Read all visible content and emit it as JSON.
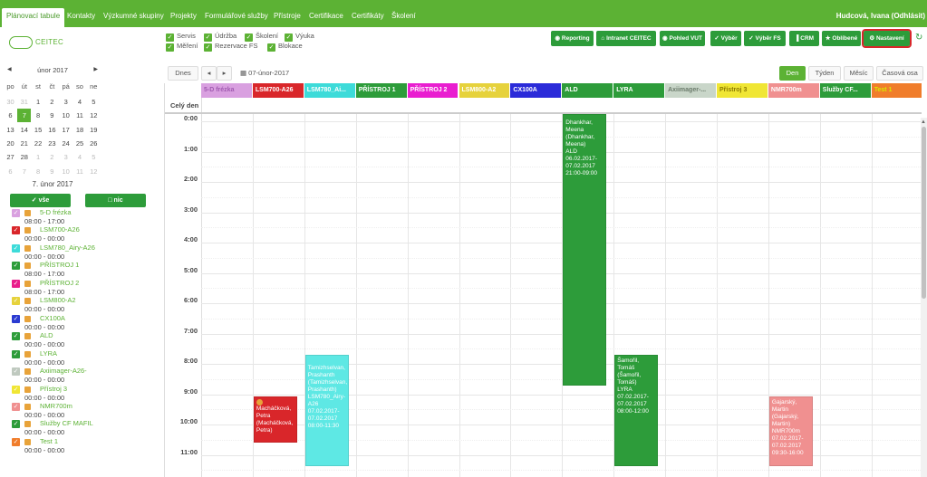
{
  "nav": {
    "items": [
      "Plánovací tabule",
      "Kontakty",
      "Výzkumné skupiny",
      "Projekty",
      "Formulářové služby",
      "Přístroje",
      "Certifikace",
      "Certifikáty",
      "Školení"
    ],
    "user": "Hudcová, Ivana (Odhlásit)"
  },
  "logo": "CEITEC",
  "filters": [
    "Servis",
    "Údržba",
    "Školení",
    "Výuka",
    "Měření",
    "Rezervace FS",
    "Blokace"
  ],
  "toolbar": [
    "Reporting",
    "Intranet CEITEC",
    "Pohled VUT",
    "Výběr",
    "Výběr FS",
    "CRM",
    "Oblíbené",
    "Nastavení"
  ],
  "mini_cal": {
    "month": "únor 2017",
    "dow": [
      "po",
      "út",
      "st",
      "čt",
      "pá",
      "so",
      "ne"
    ],
    "weeks": [
      [
        "30",
        "31",
        "1",
        "2",
        "3",
        "4",
        "5"
      ],
      [
        "6",
        "7",
        "8",
        "9",
        "10",
        "11",
        "12"
      ],
      [
        "13",
        "14",
        "15",
        "16",
        "17",
        "18",
        "19"
      ],
      [
        "20",
        "21",
        "22",
        "23",
        "24",
        "25",
        "26"
      ],
      [
        "27",
        "28",
        "1",
        "2",
        "3",
        "4",
        "5"
      ],
      [
        "6",
        "7",
        "8",
        "9",
        "10",
        "11",
        "12"
      ]
    ],
    "selected": "7",
    "date_label": "7. únor 2017"
  },
  "list_buttons": {
    "all": "vše",
    "none": "nic"
  },
  "instruments": [
    {
      "name": "5-D frézka",
      "time": "08:00 - 17:00",
      "color": "#d9a0e0"
    },
    {
      "name": "LSM700-A26",
      "time": "00:00 - 00:00",
      "color": "#d9262a"
    },
    {
      "name": "LSM780_Airy-A26",
      "time": "00:00 - 00:00",
      "color": "#3ddbd9"
    },
    {
      "name": "PŘÍSTROJ 1",
      "time": "08:00 - 17:00",
      "color": "#2d9c3a"
    },
    {
      "name": "PŘÍSTROJ 2",
      "time": "08:00 - 17:00",
      "color": "#e91e8c"
    },
    {
      "name": "LSM800-A2",
      "time": "00:00 - 00:00",
      "color": "#e6d23c"
    },
    {
      "name": "CX100A",
      "time": "00:00 - 00:00",
      "color": "#2b3bd1"
    },
    {
      "name": "ALD",
      "time": "00:00 - 00:00",
      "color": "#2d9c3a"
    },
    {
      "name": "LYRA",
      "time": "00:00 - 00:00",
      "color": "#2d9c3a"
    },
    {
      "name": "Axiimager-A26-",
      "time": "00:00 - 00:00",
      "color": "#bfc9bf"
    },
    {
      "name": "Přístroj 3",
      "time": "00:00 - 00:00",
      "color": "#f0e634"
    },
    {
      "name": "NMR700m",
      "time": "00:00 - 00:00",
      "color": "#f09090"
    },
    {
      "name": "Služby CF MAFIL",
      "time": "00:00 - 00:00",
      "color": "#2d9c3a"
    },
    {
      "name": "Test 1",
      "time": "00:00 - 00:00",
      "color": "#f07d2b"
    }
  ],
  "cal_toolbar": {
    "today": "Dnes",
    "prev": "◂",
    "next": "▸",
    "title": "07-únor-2017",
    "views": [
      "Den",
      "Týden",
      "Měsíc",
      "Časová osa"
    ]
  },
  "resources": [
    {
      "name": "5-D frézka",
      "color": "#d9a0e0",
      "text": "#a05ab0"
    },
    {
      "name": "LSM700-A26",
      "color": "#d9262a",
      "text": "#ffffff"
    },
    {
      "name": "LSM780_Ai...",
      "color": "#3ddbd9",
      "text": "#ffffff"
    },
    {
      "name": "PŘÍSTROJ 1",
      "color": "#2d9c3a",
      "text": "#ffffff"
    },
    {
      "name": "PŘÍSTROJ 2",
      "color": "#e91ed0",
      "text": "#ffffff"
    },
    {
      "name": "LSM800-A2",
      "color": "#e6d23c",
      "text": "#ffffff"
    },
    {
      "name": "CX100A",
      "color": "#2b2bd9",
      "text": "#ffffff"
    },
    {
      "name": "ALD",
      "color": "#2d9c3a",
      "text": "#ffffff"
    },
    {
      "name": "LYRA",
      "color": "#2d9c3a",
      "text": "#ffffff"
    },
    {
      "name": "Axiimager-...",
      "color": "#c9d6c9",
      "text": "#6a7a6a"
    },
    {
      "name": "Přístroj 3",
      "color": "#f0e634",
      "text": "#8a7a00"
    },
    {
      "name": "NMR700m",
      "color": "#f09090",
      "text": "#ffffff"
    },
    {
      "name": "Služby CF...",
      "color": "#2d9c3a",
      "text": "#ffffff"
    },
    {
      "name": "Test 1",
      "color": "#f07d2b",
      "text": "#d8e800"
    }
  ],
  "allday_label": "Celý den",
  "hours": [
    "0:00",
    "1:00",
    "2:00",
    "3:00",
    "4:00",
    "5:00",
    "6:00",
    "7:00",
    "8:00",
    "9:00",
    "10:00",
    "11:00"
  ],
  "events": [
    {
      "col": 7,
      "start": 0.0,
      "end": 8.95,
      "color": "#2d9c3a",
      "lines": [
        "Dhankhar,",
        "Meena",
        "(Dhankhar,",
        "Meena)",
        "ALD",
        "06.02.2017-",
        "07.02.2017",
        "21:00-09:00"
      ]
    },
    {
      "col": 2,
      "start": 7.95,
      "end": 11.6,
      "color": "#5ee8e4",
      "lines": [
        "Tamizhselvan,",
        "Prashanth",
        "(Tamizhselvan,",
        "Prashanth)",
        "LSM780_Airy-",
        "A26",
        "07.02.2017-",
        "07.02.2017",
        "08:00-11:30"
      ]
    },
    {
      "col": 8,
      "start": 7.95,
      "end": 11.6,
      "color": "#2d9c3a",
      "lines": [
        "Šamořil,",
        "Tomáš",
        "(Šamořil,",
        "Tomáš)",
        "LYRA",
        "07.02.2017-",
        "07.02.2017",
        "08:00-12:00"
      ]
    },
    {
      "col": 1,
      "start": 9.3,
      "end": 10.85,
      "color": "#d9262a",
      "lines": [
        "Macháčková,",
        "Petra",
        "(Macháčková,",
        "Petra)"
      ],
      "dot": true
    },
    {
      "col": 11,
      "start": 9.3,
      "end": 11.6,
      "color": "#f09090",
      "lines": [
        "Gajarský,",
        "Martin",
        "(Gajarský,",
        "Martin)",
        "NMR700m",
        "07.02.2017-",
        "07.02.2017",
        "09:30-16:00"
      ]
    }
  ]
}
